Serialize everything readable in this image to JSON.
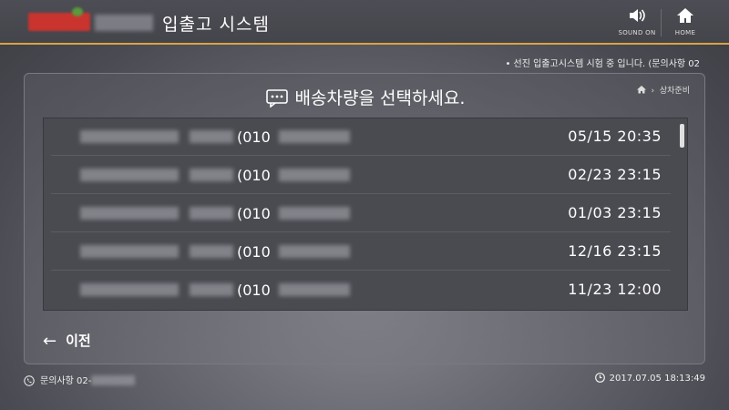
{
  "header": {
    "system_title": "입출고 시스템",
    "sound_label": "SOUND ON",
    "home_label": "HOME"
  },
  "notice": "• 선진 입출고시스템 시험 중 입니다. (문의사항 02",
  "panel": {
    "title": "배송차량을 선택하세요.",
    "breadcrumb": "상차준비"
  },
  "rows": [
    {
      "phone_prefix": "(010",
      "datetime": "05/15 20:35"
    },
    {
      "phone_prefix": "(010",
      "datetime": "02/23 23:15"
    },
    {
      "phone_prefix": "(010",
      "datetime": "01/03 23:15"
    },
    {
      "phone_prefix": "(010",
      "datetime": "12/16 23:15"
    },
    {
      "phone_prefix": "(010",
      "datetime": "11/23 12:00"
    }
  ],
  "back_label": "이전",
  "footer": {
    "contact_label": "문의사항 02-",
    "timestamp": "2017.07.05 18:13:49"
  },
  "colors": {
    "accent_line": "#d9a441",
    "header_bg": "#44444b",
    "list_bg": "#4a4a51"
  },
  "icons": [
    "speaker-icon",
    "home-icon",
    "chat-bubble-icon",
    "breadcrumb-home-icon",
    "back-arrow-icon",
    "phone-icon",
    "clock-icon"
  ]
}
